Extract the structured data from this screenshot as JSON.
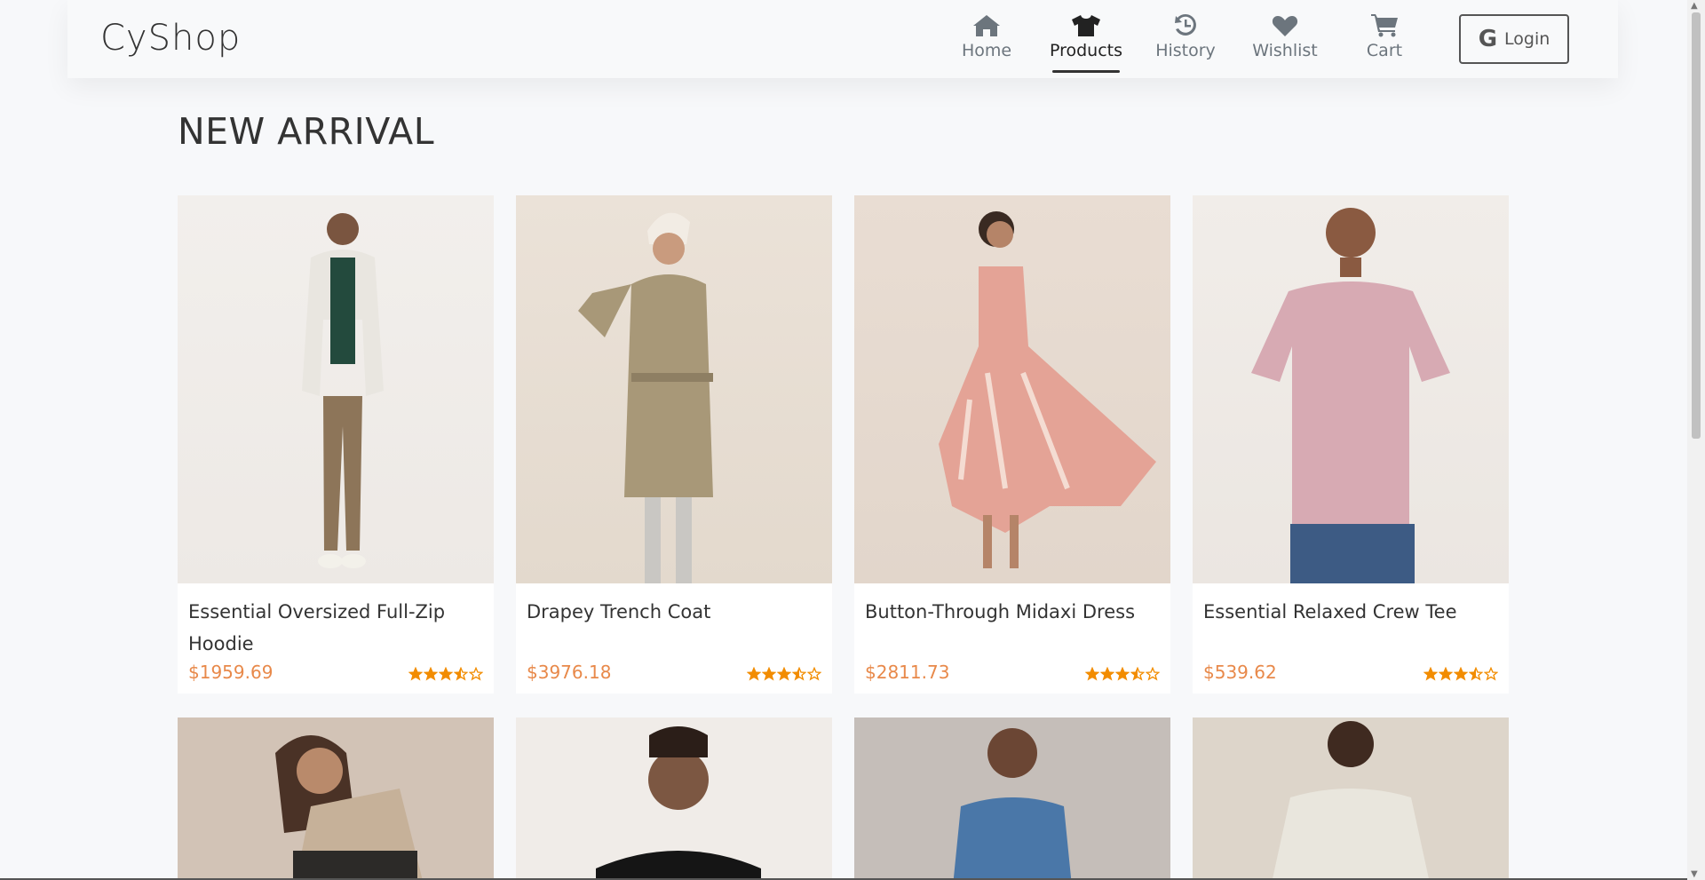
{
  "brand": "CyShop",
  "nav": [
    {
      "label": "Home",
      "icon": "home-icon",
      "active": false
    },
    {
      "label": "Products",
      "icon": "shirt-icon",
      "active": true
    },
    {
      "label": "History",
      "icon": "history-icon",
      "active": false
    },
    {
      "label": "Wishlist",
      "icon": "heart-icon",
      "active": false
    },
    {
      "label": "Cart",
      "icon": "cart-icon",
      "active": false
    }
  ],
  "login": {
    "label": "Login",
    "icon": "google-icon"
  },
  "section_title": "NEW ARRIVAL",
  "colors": {
    "price": "#e8894a",
    "star": "#f28c00",
    "background": "#f7f8fa"
  },
  "products": [
    {
      "name": "Essential Oversized Full-Zip Hoodie",
      "price": "$1959.69",
      "rating": 3.5
    },
    {
      "name": "Drapey Trench Coat",
      "price": "$3976.18",
      "rating": 3.5
    },
    {
      "name": "Button-Through Midaxi Dress",
      "price": "$2811.73",
      "rating": 3.5
    },
    {
      "name": "Essential Relaxed Crew Tee",
      "price": "$539.62",
      "rating": 3.5
    }
  ],
  "products_row2": [
    {
      "image": "woman-knit-vest-photo"
    },
    {
      "image": "man-black-sweater-photo"
    },
    {
      "image": "woman-denim-shirt-photo"
    },
    {
      "image": "man-white-tee-photo"
    }
  ]
}
